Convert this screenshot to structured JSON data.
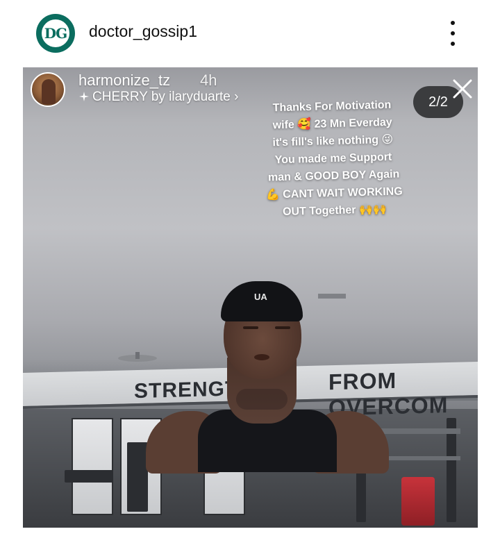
{
  "post": {
    "account_avatar_text": "DG",
    "username": "doctor_gossip1",
    "more_icon": "more-vertical-icon"
  },
  "story": {
    "username": "harmonize_tz",
    "time": "4h",
    "music_icon": "sparkle-icon",
    "music_label": "CHERRY by ilaryduarte ›",
    "counter": "2/2",
    "caption_lines": [
      "Thanks For Motivation",
      "wife 🥰 23 Mn Everday",
      "it's fill's like nothing 😜",
      "You made me Support",
      "man & GOOD BOY Again",
      "💪 CANT WAIT WORKING",
      "OUT Together 🙌🙌"
    ],
    "banner_left": "STRENGTH",
    "banner_right": "FROM OVERCOM",
    "beanie_logo": "UA"
  },
  "colors": {
    "brand_green": "#0b6d5f",
    "counter_bg": "#3b3c3e"
  }
}
